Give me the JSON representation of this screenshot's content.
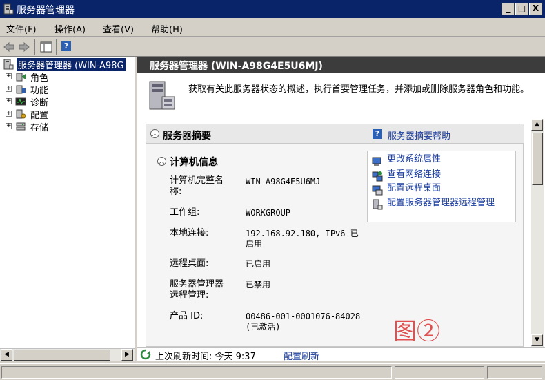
{
  "window": {
    "title": "服务器管理器",
    "controls": {
      "minimize": "_",
      "maximize": "□",
      "close": "X"
    }
  },
  "menu": [
    "文件(F)",
    "操作(A)",
    "查看(V)",
    "帮助(H)"
  ],
  "toolbar": {
    "icons": [
      "back-icon",
      "forward-icon",
      "show-hide-tree-icon",
      "help-icon"
    ],
    "help_glyph": "?"
  },
  "tree": {
    "root": "服务器管理器 (WIN-A98G",
    "items": [
      "角色",
      "功能",
      "诊断",
      "配置",
      "存储"
    ],
    "expander": "+"
  },
  "content": {
    "header": "服务器管理器 (WIN-A98G4E5U6MJ)",
    "intro": "获取有关此服务器状态的概述，执行首要管理任务，并添加或删除服务器角色和功能。",
    "summary": {
      "title": "服务器摘要",
      "help_link": "服务器摘要帮助",
      "collapse_glyph": "︿",
      "section_title": "计算机信息",
      "fields": [
        {
          "label": "计算机完整名称:",
          "value": "WIN-A98G4E5U6MJ"
        },
        {
          "label": "工作组:",
          "value": "WORKGROUP"
        },
        {
          "label": "本地连接:",
          "value": "192.168.92.180, IPv6 已启用"
        },
        {
          "label": "远程桌面:",
          "value": "已启用"
        },
        {
          "label": "服务器管理器远程管理:",
          "value": "已禁用"
        },
        {
          "label": "产品 ID:",
          "value": "00486-001-0001076-84028 (已激活)"
        }
      ],
      "tasks": [
        "更改系统属性",
        "查看网络连接",
        "配置远程桌面",
        "配置服务器管理器远程管理"
      ]
    },
    "watermark": "图②",
    "footer": {
      "refresh_text": "上次刷新时间: 今天 9:37",
      "refresh_link": "配置刷新"
    }
  },
  "scroll": {
    "up": "▲",
    "down": "▼",
    "left": "◀",
    "right": "▶"
  }
}
